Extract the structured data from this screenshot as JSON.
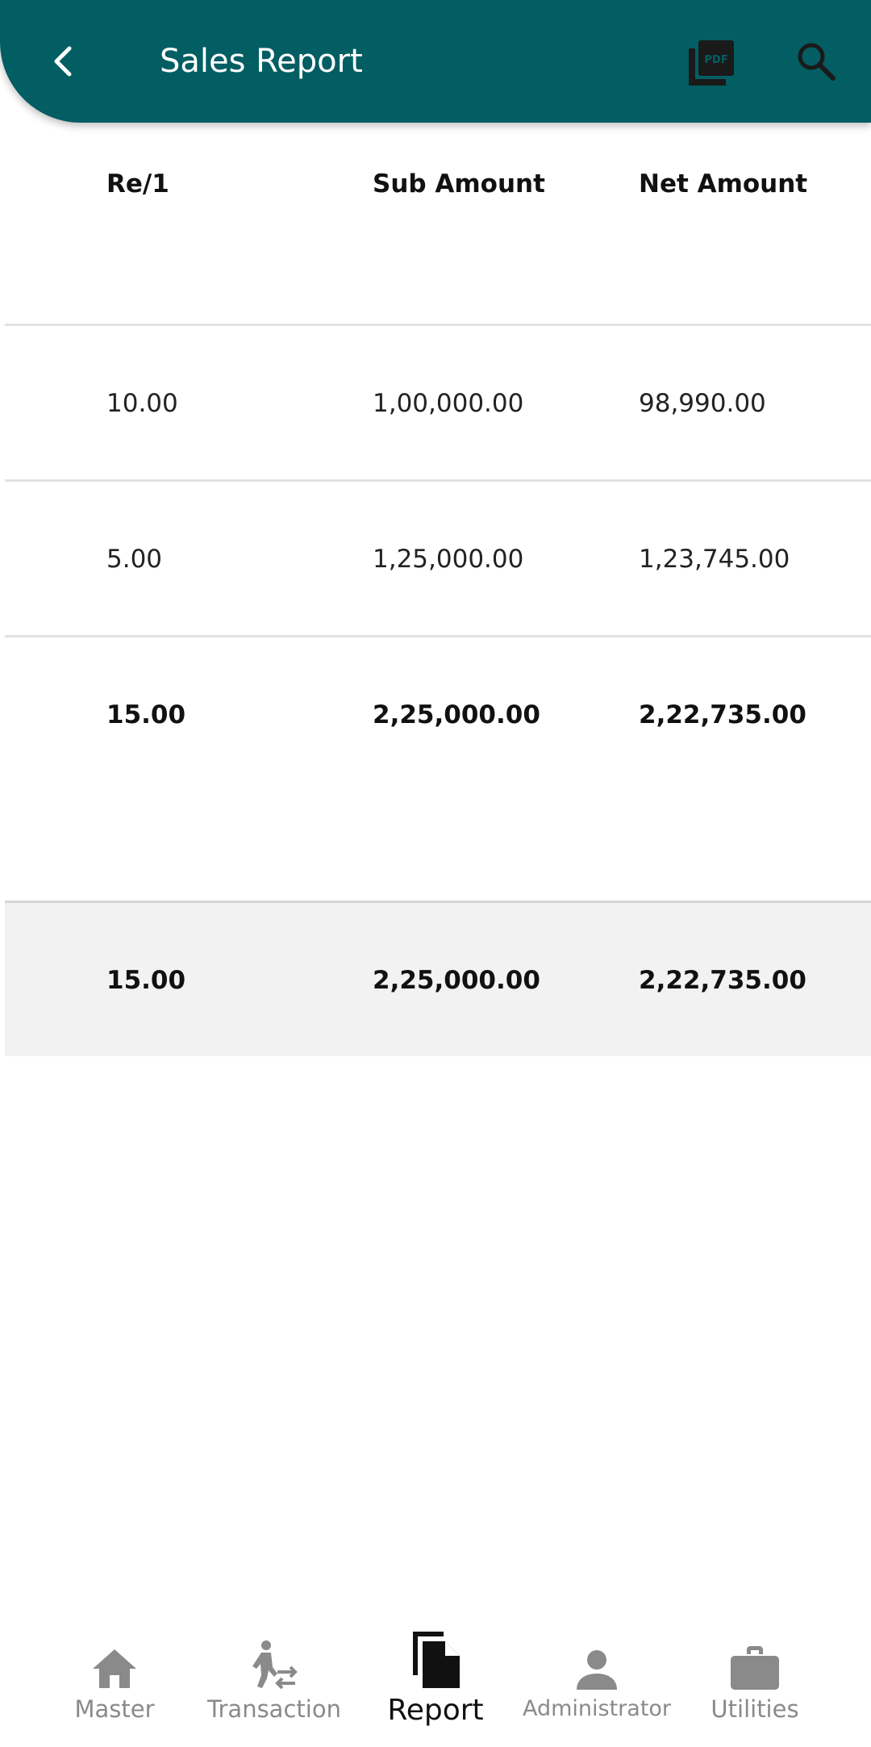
{
  "appbar": {
    "title": "Sales Report",
    "back_icon": "chevron-left-icon",
    "pdf_icon": "pdf-icon",
    "search_icon": "search-icon",
    "color": "#035e63"
  },
  "table": {
    "columns": [
      "Re/1",
      "Sub Amount",
      "Net Amount"
    ],
    "rows": [
      [
        "10.00",
        "1,00,000.00",
        "98,990.00"
      ],
      [
        "5.00",
        "1,25,000.00",
        "1,23,745.00"
      ]
    ],
    "total": [
      "15.00",
      "2,25,000.00",
      "2,22,735.00"
    ],
    "grand_total": [
      "15.00",
      "2,25,000.00",
      "2,22,735.00"
    ]
  },
  "bottom_nav": {
    "items": [
      {
        "label": "Master",
        "icon": "home-icon",
        "active": false
      },
      {
        "label": "Transaction",
        "icon": "transaction-icon",
        "active": false
      },
      {
        "label": "Report",
        "icon": "report-icon",
        "active": true
      },
      {
        "label": "Administrator",
        "icon": "person-icon",
        "active": false
      },
      {
        "label": "Utilities",
        "icon": "briefcase-icon",
        "active": false
      }
    ]
  }
}
